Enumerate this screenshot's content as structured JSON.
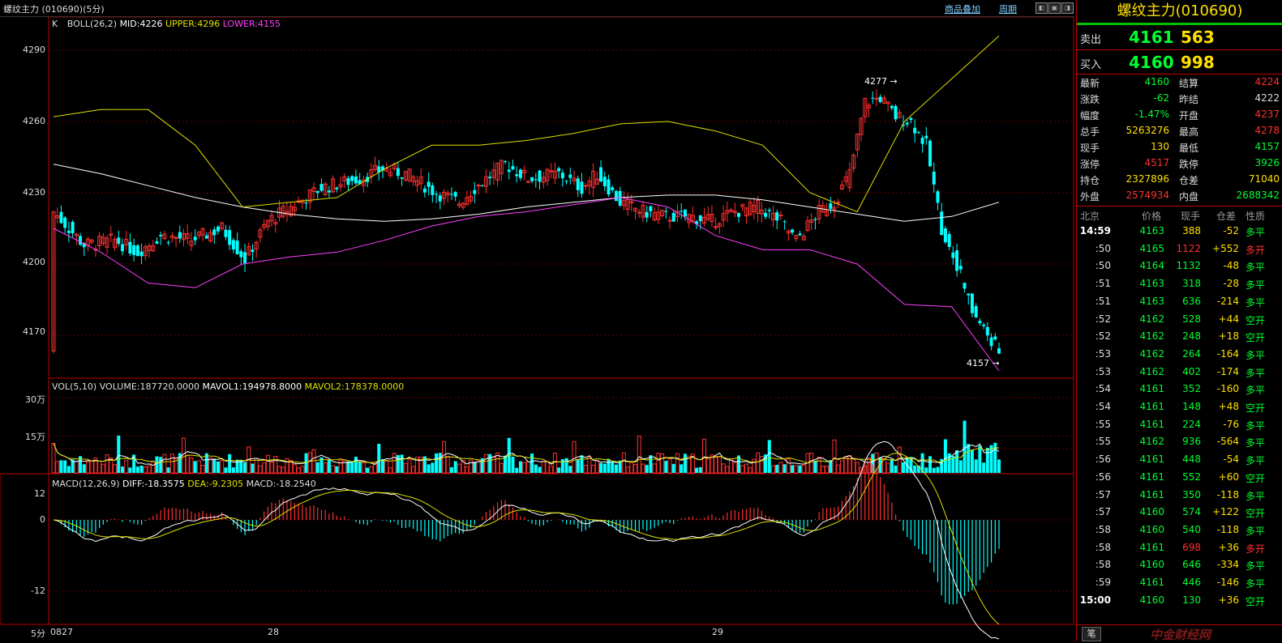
{
  "topbar": {
    "title": "螺纹主力 (010690)(5分)",
    "menu1": "商品叠加",
    "menu2": "周期"
  },
  "main_panel": {
    "label_k": "K",
    "boll": "BOLL(26,2)",
    "mid": "MID:4226",
    "upper": "UPPER:4296",
    "lower": "LOWER:4155",
    "y_ticks": [
      "4290",
      "4260",
      "4230",
      "4200",
      "4170"
    ],
    "high_mark": "4277",
    "low_mark": "4157"
  },
  "vol_panel": {
    "label": "VOL(5,10)",
    "volume": "VOLUME:187720.0000",
    "mavol1": "MAVOL1:194978.8000",
    "mavol2": "MAVOL2:178378.0000",
    "y_ticks": [
      "30万",
      "15万"
    ]
  },
  "macd_panel": {
    "label": "MACD(12,26,9)",
    "diff": "DIFF:-18.3575",
    "dea": "DEA:-9.2305",
    "macd": "MACD:-18.2540",
    "y_ticks": [
      "12",
      "0",
      "-12"
    ]
  },
  "x_axis": {
    "period": "5分",
    "labels": [
      "0827",
      "28",
      "29"
    ]
  },
  "quote": {
    "title": "螺纹主力(010690)",
    "sell": {
      "label": "卖出",
      "price": "4161",
      "vol": "563"
    },
    "buy": {
      "label": "买入",
      "price": "4160",
      "vol": "998"
    },
    "rows": [
      {
        "l1": "最新",
        "v1": "4160",
        "c1": "#00ff30",
        "l2": "结算",
        "v2": "4224",
        "c2": "#ff3030"
      },
      {
        "l1": "涨跌",
        "v1": "-62",
        "c1": "#00ff30",
        "l2": "昨结",
        "v2": "4222",
        "c2": "#dddddd"
      },
      {
        "l1": "幅度",
        "v1": "-1.47%",
        "c1": "#00ff30",
        "l2": "开盘",
        "v2": "4237",
        "c2": "#ff3030"
      },
      {
        "l1": "总手",
        "v1": "5263276",
        "c1": "#ffe000",
        "l2": "最高",
        "v2": "4278",
        "c2": "#ff3030"
      },
      {
        "l1": "现手",
        "v1": "130",
        "c1": "#ffe000",
        "l2": "最低",
        "v2": "4157",
        "c2": "#00ff30"
      },
      {
        "l1": "涨停",
        "v1": "4517",
        "c1": "#ff3030",
        "l2": "跌停",
        "v2": "3926",
        "c2": "#00ff30"
      },
      {
        "l1": "持仓",
        "v1": "2327896",
        "c1": "#ffe000",
        "l2": "仓差",
        "v2": "71040",
        "c2": "#ffe000"
      },
      {
        "l1": "外盘",
        "v1": "2574934",
        "c1": "#ff3030",
        "l2": "内盘",
        "v2": "2688342",
        "c2": "#00ff30"
      }
    ],
    "tick_header": {
      "time": "北京",
      "price": "价格",
      "vol": "现手",
      "oi": "仓差",
      "nature": "性质"
    },
    "ticks": [
      {
        "time": "14:59",
        "price": "4163",
        "vol": "388",
        "oi": "-52",
        "nature": "多平",
        "vc": "#ffe000",
        "nc": "#00ff30"
      },
      {
        "time": ":50",
        "price": "4165",
        "vol": "1122",
        "oi": "+552",
        "nature": "多开",
        "vc": "#ff3030",
        "nc": "#ff3030"
      },
      {
        "time": ":50",
        "price": "4164",
        "vol": "1132",
        "oi": "-48",
        "nature": "多平",
        "vc": "#00ff30",
        "nc": "#00ff30"
      },
      {
        "time": ":51",
        "price": "4163",
        "vol": "318",
        "oi": "-28",
        "nature": "多平",
        "vc": "#00ff30",
        "nc": "#00ff30"
      },
      {
        "time": ":51",
        "price": "4163",
        "vol": "636",
        "oi": "-214",
        "nature": "多平",
        "vc": "#00ff30",
        "nc": "#00ff30"
      },
      {
        "time": ":52",
        "price": "4162",
        "vol": "528",
        "oi": "+44",
        "nature": "空开",
        "vc": "#00ff30",
        "nc": "#00ff30"
      },
      {
        "time": ":52",
        "price": "4162",
        "vol": "248",
        "oi": "+18",
        "nature": "空开",
        "vc": "#00ff30",
        "nc": "#00ff30"
      },
      {
        "time": ":53",
        "price": "4162",
        "vol": "264",
        "oi": "-164",
        "nature": "多平",
        "vc": "#00ff30",
        "nc": "#00ff30"
      },
      {
        "time": ":53",
        "price": "4162",
        "vol": "402",
        "oi": "-174",
        "nature": "多平",
        "vc": "#00ff30",
        "nc": "#00ff30"
      },
      {
        "time": ":54",
        "price": "4161",
        "vol": "352",
        "oi": "-160",
        "nature": "多平",
        "vc": "#00ff30",
        "nc": "#00ff30"
      },
      {
        "time": ":54",
        "price": "4161",
        "vol": "148",
        "oi": "+48",
        "nature": "空开",
        "vc": "#00ff30",
        "nc": "#00ff30"
      },
      {
        "time": ":55",
        "price": "4161",
        "vol": "224",
        "oi": "-76",
        "nature": "多平",
        "vc": "#00ff30",
        "nc": "#00ff30"
      },
      {
        "time": ":55",
        "price": "4162",
        "vol": "936",
        "oi": "-564",
        "nature": "多平",
        "vc": "#00ff30",
        "nc": "#00ff30"
      },
      {
        "time": ":56",
        "price": "4161",
        "vol": "448",
        "oi": "-54",
        "nature": "多平",
        "vc": "#00ff30",
        "nc": "#00ff30"
      },
      {
        "time": ":56",
        "price": "4161",
        "vol": "552",
        "oi": "+60",
        "nature": "空开",
        "vc": "#00ff30",
        "nc": "#00ff30"
      },
      {
        "time": ":57",
        "price": "4161",
        "vol": "350",
        "oi": "-118",
        "nature": "多平",
        "vc": "#00ff30",
        "nc": "#00ff30"
      },
      {
        "time": ":57",
        "price": "4160",
        "vol": "574",
        "oi": "+122",
        "nature": "空开",
        "vc": "#00ff30",
        "nc": "#00ff30"
      },
      {
        "time": ":58",
        "price": "4160",
        "vol": "540",
        "oi": "-118",
        "nature": "多平",
        "vc": "#00ff30",
        "nc": "#00ff30"
      },
      {
        "time": ":58",
        "price": "4161",
        "vol": "698",
        "oi": "+36",
        "nature": "多开",
        "vc": "#ff3030",
        "nc": "#ff3030"
      },
      {
        "time": ":58",
        "price": "4160",
        "vol": "646",
        "oi": "-334",
        "nature": "多平",
        "vc": "#00ff30",
        "nc": "#00ff30"
      },
      {
        "time": ":59",
        "price": "4161",
        "vol": "446",
        "oi": "-146",
        "nature": "多平",
        "vc": "#00ff30",
        "nc": "#00ff30"
      },
      {
        "time": "15:00",
        "price": "4160",
        "vol": "130",
        "oi": "+36",
        "nature": "空开",
        "vc": "#00ff30",
        "nc": "#00ff30"
      }
    ],
    "footer_tab": "笔",
    "watermark": "中金财经网"
  },
  "chart_data": [
    {
      "type": "line",
      "title": "BOLL(26,2)",
      "series": [
        {
          "name": "MID",
          "values": [
            4242,
            4238,
            4233,
            4228,
            4224,
            4221,
            4219,
            4218,
            4219,
            4221,
            4224,
            4226,
            4228,
            4229,
            4229,
            4227,
            4224,
            4221,
            4218,
            4220,
            4226
          ]
        },
        {
          "name": "UPPER",
          "values": [
            4262,
            4265,
            4265,
            4250,
            4224,
            4226,
            4228,
            4240,
            4250,
            4250,
            4252,
            4255,
            4259,
            4260,
            4256,
            4250,
            4230,
            4222,
            4260,
            4278,
            4296
          ]
        },
        {
          "name": "LOWER",
          "values": [
            4215,
            4205,
            4192,
            4190,
            4200,
            4203,
            4205,
            4210,
            4216,
            4220,
            4222,
            4225,
            4228,
            4224,
            4212,
            4206,
            4206,
            4200,
            4183,
            4182,
            4155
          ]
        }
      ]
    },
    {
      "type": "bar",
      "title": "VOL(5,10)",
      "ylabel": "",
      "y_ticks": [
        "30万",
        "15万"
      ]
    },
    {
      "type": "bar",
      "title": "MACD(12,26,9)",
      "y_ticks": [
        "12",
        "0",
        "-12"
      ]
    }
  ]
}
